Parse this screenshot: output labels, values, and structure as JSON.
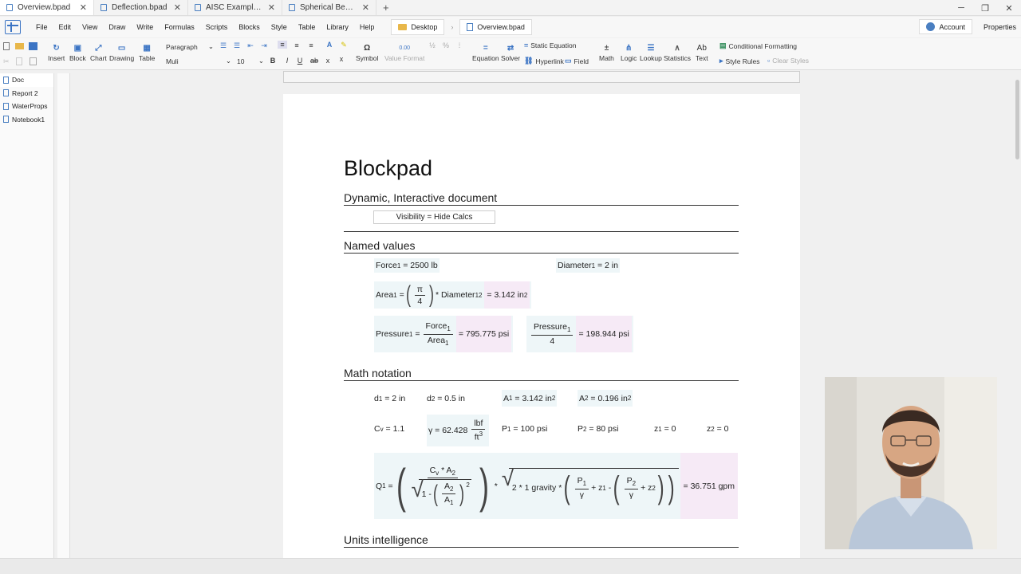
{
  "tabs": [
    {
      "label": "Overview.bpad",
      "active": true
    },
    {
      "label": "Deflection.bpad",
      "active": false
    },
    {
      "label": "AISC Example D1.b...",
      "active": false
    },
    {
      "label": "Spherical Bearings...",
      "active": false
    }
  ],
  "menu": [
    "File",
    "Edit",
    "View",
    "Draw",
    "Write",
    "Formulas",
    "Scripts",
    "Blocks",
    "Style",
    "Table",
    "Library",
    "Help"
  ],
  "breadcrumb": {
    "folder": "Desktop",
    "file": "Overview.bpad"
  },
  "header_right": {
    "account": "Account",
    "properties": "Properties"
  },
  "ribbon": {
    "insert": "Insert",
    "block": "Block",
    "chart": "Chart",
    "drawing": "Drawing",
    "table": "Table",
    "paragraph_style": "Paragraph",
    "font": "Muli",
    "font_size": "10",
    "symbol": "Symbol",
    "symbol_glyph": "Ω",
    "value_format": "Value Format",
    "value_format_sample": "0.00",
    "equation": "Equation",
    "solver": "Solver",
    "static_equation": "Static Equation",
    "hyperlink": "Hyperlink",
    "field": "Field",
    "math": "Math",
    "logic": "Logic",
    "lookup": "Lookup",
    "statistics": "Statistics",
    "text": "Text",
    "text_glyph": "Ab",
    "conditional_formatting": "Conditional Formatting",
    "style_rules": "Style Rules",
    "clear_styles": "Clear Styles",
    "bold": "B",
    "italic": "I",
    "underline": "U",
    "strike": "ab",
    "subscript": "x",
    "superscript": "x",
    "font_color": "A",
    "half": "½",
    "percent": "%"
  },
  "sidebar": [
    {
      "label": "Doc",
      "active": true
    },
    {
      "label": "Report 2",
      "active": false
    },
    {
      "label": "WaterProps",
      "active": false
    },
    {
      "label": "Notebook1",
      "active": false
    }
  ],
  "document": {
    "title": "Blockpad",
    "sections": {
      "dynamic": "Dynamic, Interactive document",
      "named": "Named values",
      "math": "Math notation",
      "units": "Units intelligence"
    },
    "visibility": "Visibility = Hide Calcs",
    "named_values": {
      "force_lhs": "Force",
      "force_sub": "1",
      "force_rhs": "= 2500 lb",
      "diam_lhs": "Diameter",
      "diam_sub": "1",
      "diam_rhs": "= 2 in",
      "area_lhs": "Area",
      "area_sub": "1",
      "area_eq": "=",
      "area_pi": "π",
      "area_four": "4",
      "area_mul": "* Diameter",
      "area_d_sub": "1",
      "area_d_sup": "2",
      "area_result": "= 3.142 in",
      "area_result_sup": "2",
      "pressure_lhs": "Pressure",
      "pressure_sub": "1",
      "pressure_eq": "=",
      "pressure_num": "Force",
      "pressure_num_sub": "1",
      "pressure_den": "Area",
      "pressure_den_sub": "1",
      "pressure_result": "= 795.775 psi",
      "p4_num": "Pressure",
      "p4_num_sub": "1",
      "p4_den": "4",
      "p4_result": "= 198.944 psi"
    },
    "math_notation": {
      "d1": "d",
      "d1_sub": "1",
      "d1_rhs": "= 2 in",
      "d2": "d",
      "d2_sub": "2",
      "d2_rhs": "= 0.5 in",
      "a1": "A",
      "a1_sub": "1",
      "a1_rhs": "= 3.142 in",
      "a1_sup": "2",
      "a2": "A",
      "a2_sub": "2",
      "a2_rhs": "= 0.196 in",
      "a2_sup": "2",
      "cv": "C",
      "cv_sub": "v",
      "cv_rhs": "= 1.1",
      "gamma": "γ",
      "gamma_rhs": "= 62.428",
      "gamma_num": "lbf",
      "gamma_den": "ft",
      "gamma_den_sup": "3",
      "p1": "P",
      "p1_sub": "1",
      "p1_rhs": "= 100 psi",
      "p2": "P",
      "p2_sub": "2",
      "p2_rhs": "= 80 psi",
      "z1": "z",
      "z1_sub": "1",
      "z1_rhs": "= 0",
      "z2": "z",
      "z2_sub": "2",
      "z2_rhs": "= 0",
      "q_lhs": "Q",
      "q_sub": "1",
      "q_eq": "=",
      "q_num_c": "C",
      "q_num_c_sub": "v",
      "q_num_mul": "* A",
      "q_num_a_sub": "2",
      "q_den_one": "1 -",
      "q_den_a2": "A",
      "q_den_a2_sub": "2",
      "q_den_a1": "A",
      "q_den_a1_sub": "1",
      "q_den_sup": "2",
      "q_mul": "*",
      "q_sqrt_lead": "2 * 1 gravity *",
      "q_p1": "P",
      "q_p1_sub": "1",
      "q_g1": "γ",
      "q_plus_z1": "+ z",
      "q_z1_sub": "1",
      "q_minus": "-",
      "q_p2": "P",
      "q_p2_sub": "2",
      "q_g2": "γ",
      "q_plus_z2": "+ z",
      "q_z2_sub": "2",
      "q_result": "= 36.751 gpm"
    }
  }
}
